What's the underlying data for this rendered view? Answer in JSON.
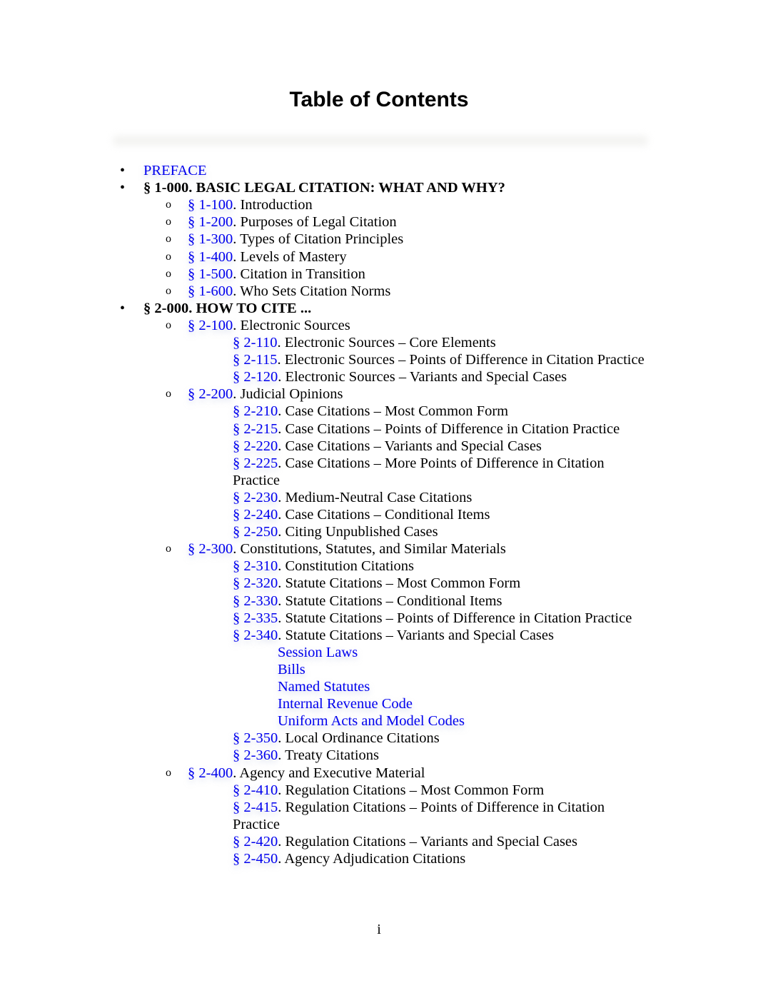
{
  "page": {
    "title": "Table of Contents",
    "page_number": "i",
    "link_color": "#0000ee"
  },
  "toc": {
    "preface": "PREFACE",
    "s1": {
      "heading": "§ 1-000. BASIC LEGAL CITATION: WHAT AND WHY?",
      "items": [
        {
          "num": "§ 1-100",
          "title": ". Introduction"
        },
        {
          "num": "§ 1-200",
          "title": ". Purposes of Legal Citation"
        },
        {
          "num": "§ 1-300",
          "title": ". Types of Citation Principles"
        },
        {
          "num": "§ 1-400",
          "title": ". Levels of Mastery"
        },
        {
          "num": "§ 1-500",
          "title": ". Citation in Transition"
        },
        {
          "num": "§ 1-600",
          "title": ". Who Sets Citation Norms"
        }
      ]
    },
    "s2": {
      "heading": "§ 2-000. HOW TO CITE ...",
      "s2100": {
        "num": "§ 2-100",
        "title": ". Electronic Sources",
        "items": [
          {
            "num": "§ 2-110",
            "title": ". Electronic Sources – Core Elements"
          },
          {
            "num": "§ 2-115",
            "title": ". Electronic Sources – Points of Difference in Citation Practice"
          },
          {
            "num": "§ 2-120",
            "title": ". Electronic Sources – Variants and Special Cases"
          }
        ]
      },
      "s2200": {
        "num": "§ 2-200",
        "title": ". Judicial Opinions",
        "items": [
          {
            "num": "§ 2-210",
            "title": ". Case Citations – Most Common Form"
          },
          {
            "num": "§ 2-215",
            "title": ". Case Citations – Points of Difference in Citation Practice"
          },
          {
            "num": "§ 2-220",
            "title": ". Case Citations – Variants and Special Cases"
          },
          {
            "num": "§ 2-225",
            "title": ". Case Citations – More Points of Difference in Citation",
            "cont": "Practice"
          },
          {
            "num": "§ 2-230",
            "title": ". Medium-Neutral Case Citations"
          },
          {
            "num": "§ 2-240",
            "title": ". Case Citations – Conditional Items"
          },
          {
            "num": "§ 2-250",
            "title": ". Citing Unpublished Cases"
          }
        ]
      },
      "s2300": {
        "num": "§ 2-300",
        "title": ". Constitutions, Statutes, and Similar Materials",
        "items": [
          {
            "num": "§ 2-310",
            "title": ". Constitution Citations"
          },
          {
            "num": "§ 2-320",
            "title": ". Statute Citations – Most Common Form"
          },
          {
            "num": "§ 2-330",
            "title": ". Statute Citations – Conditional Items"
          },
          {
            "num": "§ 2-335",
            "title": ". Statute Citations – Points of Difference in Citation Practice"
          },
          {
            "num": "§ 2-340",
            "title": ". Statute Citations – Variants and Special Cases"
          },
          {
            "num": "§ 2-350",
            "title": ". Local Ordinance Citations"
          },
          {
            "num": "§ 2-360",
            "title": ". Treaty Citations"
          }
        ],
        "subitems": [
          "Session Laws",
          "Bills",
          "Named Statutes",
          "Internal Revenue Code",
          "Uniform Acts and Model Codes"
        ]
      },
      "s2400": {
        "num": "§ 2-400",
        "title": ". Agency and Executive Material",
        "items": [
          {
            "num": "§ 2-410",
            "title": ". Regulation Citations – Most Common Form"
          },
          {
            "num": "§ 2-415",
            "title": ". Regulation Citations – Points of Difference in Citation",
            "cont": "Practice"
          },
          {
            "num": "§ 2-420",
            "title": ". Regulation Citations – Variants and Special Cases"
          },
          {
            "num": "§ 2-450",
            "title": ". Agency Adjudication Citations"
          }
        ]
      }
    },
    "bullet_glyph": "•",
    "circle_glyph": "o"
  }
}
